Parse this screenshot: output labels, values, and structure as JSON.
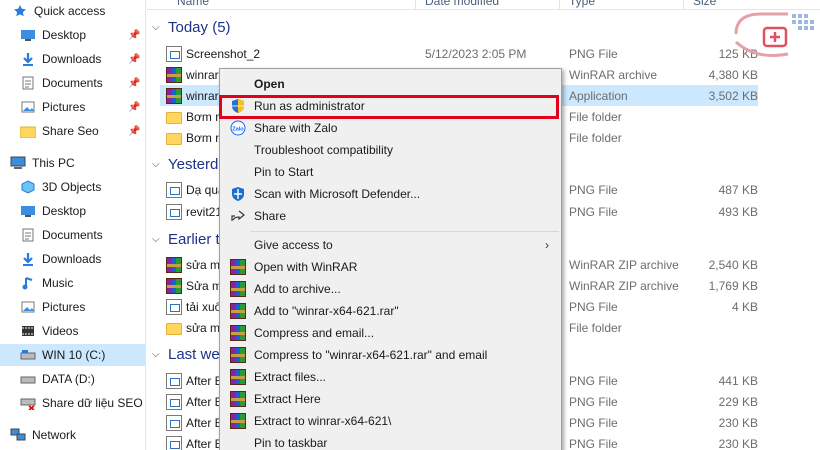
{
  "sidebar": {
    "quick_access": "Quick access",
    "items": [
      {
        "label": "Desktop",
        "icon": "desktop-icon",
        "pinned": true
      },
      {
        "label": "Downloads",
        "icon": "download-icon",
        "pinned": true
      },
      {
        "label": "Documents",
        "icon": "documents-icon",
        "pinned": true
      },
      {
        "label": "Pictures",
        "icon": "pictures-icon",
        "pinned": true
      },
      {
        "label": "Share Seo",
        "icon": "folder-icon",
        "pinned": true
      }
    ],
    "this_pc": "This PC",
    "pc_items": [
      {
        "label": "3D Objects",
        "icon": "3d-objects-icon"
      },
      {
        "label": "Desktop",
        "icon": "desktop-icon"
      },
      {
        "label": "Documents",
        "icon": "documents-icon"
      },
      {
        "label": "Downloads",
        "icon": "download-icon"
      },
      {
        "label": "Music",
        "icon": "music-icon"
      },
      {
        "label": "Pictures",
        "icon": "pictures-icon"
      },
      {
        "label": "Videos",
        "icon": "videos-icon"
      },
      {
        "label": "WIN 10 (C:)",
        "icon": "drive-c-icon",
        "selected": true
      },
      {
        "label": "DATA (D:)",
        "icon": "drive-icon"
      },
      {
        "label": "Share dữ liệu SEO (\\",
        "icon": "network-drive-icon"
      }
    ],
    "network": "Network"
  },
  "columns": {
    "name": "Name",
    "date": "Date modified",
    "type": "Type",
    "size": "Size"
  },
  "groups": [
    {
      "label": "Today (5)"
    },
    {
      "label": "Yesterda"
    },
    {
      "label": "Earlier t"
    },
    {
      "label": "Last we"
    }
  ],
  "files": [
    {
      "name": "Screenshot_2",
      "date": "5/12/2023 2:05 PM",
      "type": "PNG File",
      "size": "125 KB",
      "icon": "png"
    },
    {
      "name": "winrar",
      "date": "",
      "type": "WinRAR archive",
      "size": "4,380 KB",
      "icon": "rar"
    },
    {
      "name": "winrar",
      "date": "",
      "type": "Application",
      "size": "3,502 KB",
      "icon": "rar",
      "selected": true
    },
    {
      "name": "Bơm n",
      "date": "",
      "type": "File folder",
      "size": "",
      "icon": "folder"
    },
    {
      "name": "Bơm n",
      "date": "",
      "type": "File folder",
      "size": "",
      "icon": "folder"
    },
    {
      "name": "Dạ qua",
      "date": "",
      "type": "PNG File",
      "size": "487 KB",
      "icon": "png"
    },
    {
      "name": "revit21",
      "date": "",
      "type": "PNG File",
      "size": "493 KB",
      "icon": "png"
    },
    {
      "name": "sửa m",
      "date": "",
      "type": "WinRAR ZIP archive",
      "size": "2,540 KB",
      "icon": "rar"
    },
    {
      "name": "Sửa m",
      "date": "",
      "type": "WinRAR ZIP archive",
      "size": "1,769 KB",
      "icon": "rar"
    },
    {
      "name": "tải xuố",
      "date": "",
      "type": "PNG File",
      "size": "4 KB",
      "icon": "png"
    },
    {
      "name": "sửa m",
      "date": "",
      "type": "File folder",
      "size": "",
      "icon": "folder"
    },
    {
      "name": "After E",
      "date": "",
      "type": "PNG File",
      "size": "441 KB",
      "icon": "png"
    },
    {
      "name": "After E",
      "date": "",
      "type": "PNG File",
      "size": "229 KB",
      "icon": "png"
    },
    {
      "name": "After E",
      "date": "",
      "type": "PNG File",
      "size": "230 KB",
      "icon": "png"
    },
    {
      "name": "After E",
      "date": "",
      "type": "PNG File",
      "size": "230 KB",
      "icon": "png"
    }
  ],
  "context_menu": [
    {
      "label": "Open",
      "icon": "",
      "bold": true
    },
    {
      "label": "Run as administrator",
      "icon": "uac-shield-icon"
    },
    {
      "label": "Share with Zalo",
      "icon": "zalo-icon"
    },
    {
      "label": "Troubleshoot compatibility",
      "icon": ""
    },
    {
      "label": "Pin to Start",
      "icon": ""
    },
    {
      "label": "Scan with Microsoft Defender...",
      "icon": "defender-icon"
    },
    {
      "label": "Share",
      "icon": "share-icon"
    },
    {
      "label": "Give access to",
      "icon": "",
      "submenu": true
    },
    {
      "label": "Open with WinRAR",
      "icon": "winrar-icon"
    },
    {
      "label": "Add to archive...",
      "icon": "winrar-icon"
    },
    {
      "label": "Add to \"winrar-x64-621.rar\"",
      "icon": "winrar-icon"
    },
    {
      "label": "Compress and email...",
      "icon": "winrar-icon"
    },
    {
      "label": "Compress to \"winrar-x64-621.rar\" and email",
      "icon": "winrar-icon"
    },
    {
      "label": "Extract files...",
      "icon": "winrar-icon"
    },
    {
      "label": "Extract Here",
      "icon": "winrar-icon"
    },
    {
      "label": "Extract to winrar-x64-621\\",
      "icon": "winrar-icon"
    },
    {
      "label": "Pin to taskbar",
      "icon": ""
    }
  ],
  "colors": {
    "highlight_box": "#e3001b",
    "selection": "#cce8ff",
    "group_header": "#1e3287"
  }
}
